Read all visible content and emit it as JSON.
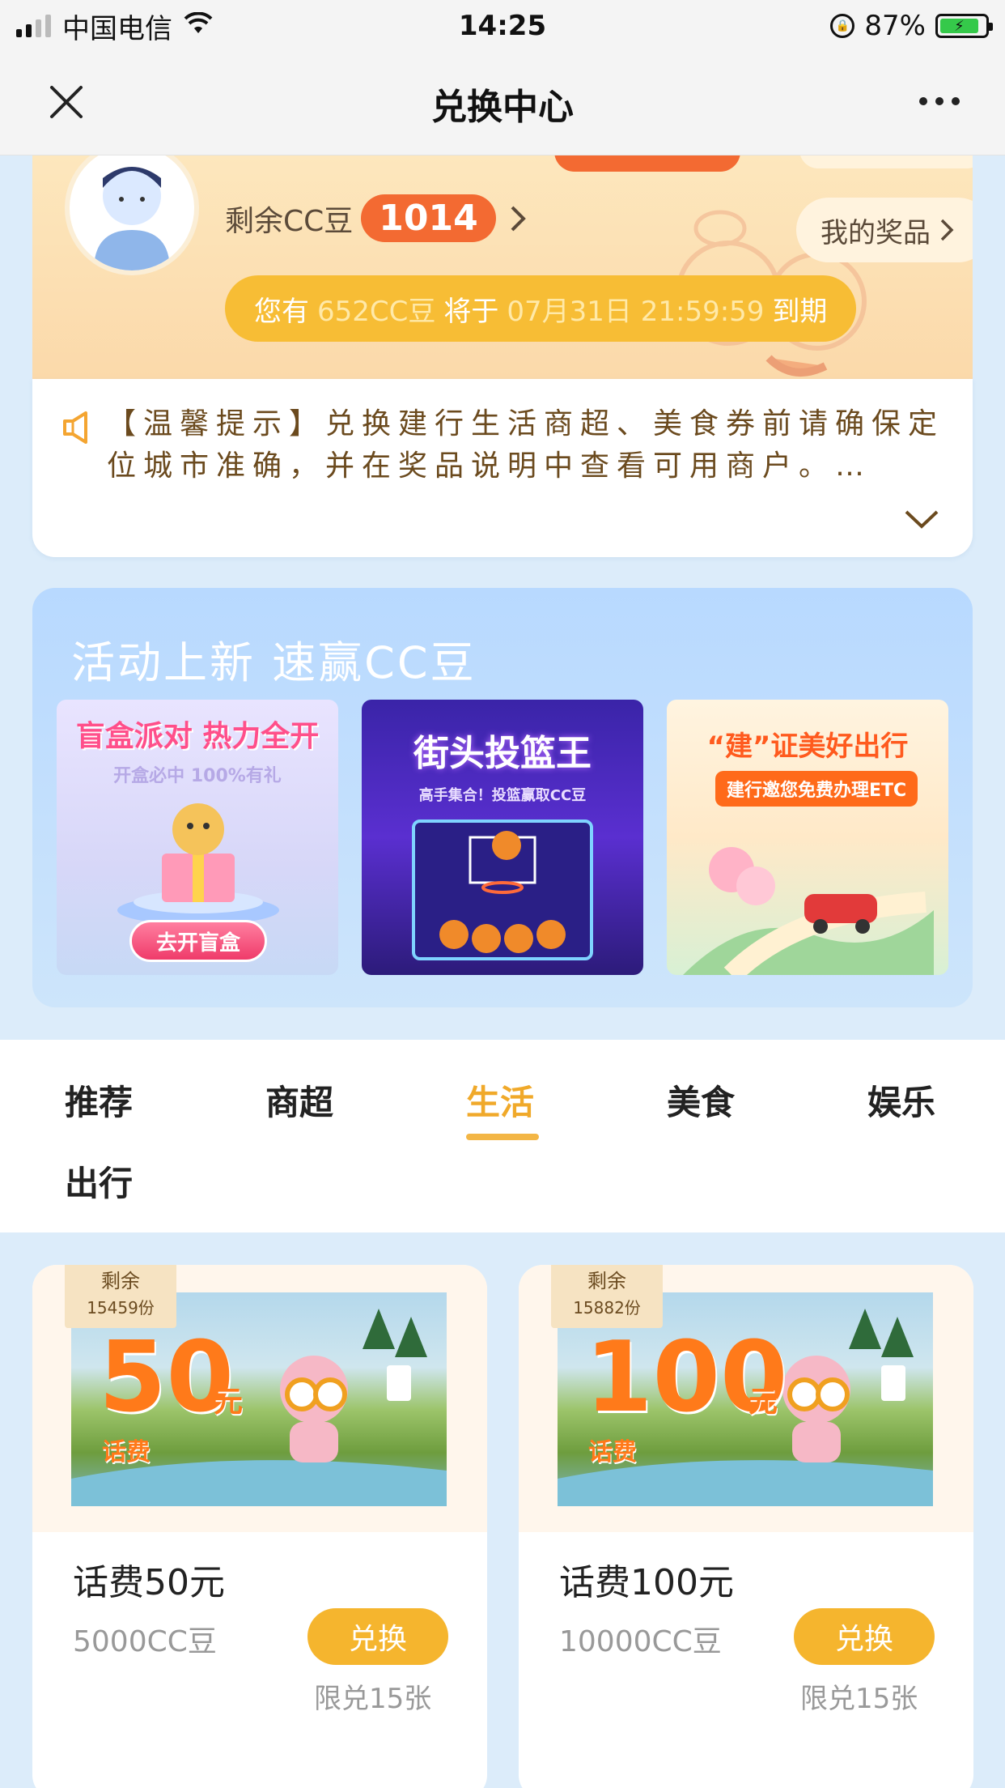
{
  "status_bar": {
    "carrier": "中国电信",
    "time": "14:25",
    "battery_percent": "87%",
    "battery_level": 0.87
  },
  "nav": {
    "title": "兑换中心",
    "close_icon": "close-icon",
    "more_icon": "more-icon"
  },
  "header": {
    "beans_label": "剩余CC豆",
    "beans_value": "1014",
    "prize_button": "我的奖品",
    "expiry": {
      "prefix": "您有",
      "amount": "652CC豆",
      "middle": "将于",
      "datetime": "07月31日 21:59:59",
      "suffix": "到期"
    }
  },
  "notice": {
    "text": "【温馨提示】兑换建行生活商超、美食券前请确保定位城市准确，并在奖品说明中查看可用商户。…"
  },
  "activity": {
    "title": "活动上新 速赢CC豆",
    "cards": [
      {
        "headline": "盲盒派对 热力全开",
        "sub": "开盒必中 100%有礼",
        "button": "去开盲盒"
      },
      {
        "headline": "街头投篮王",
        "sub": "高手集合！投篮赢取CC豆"
      },
      {
        "headline": "“建”证美好出行",
        "sub": "建行邀您免费办理ETC"
      }
    ]
  },
  "tabs": {
    "items": [
      "推荐",
      "商超",
      "生活",
      "美食",
      "娱乐",
      "出行"
    ],
    "active_index": 2
  },
  "products": [
    {
      "remain_label": "剩余",
      "remain_count": "15459份",
      "amount": "50",
      "unit": "元",
      "kind": "话费",
      "title": "话费50元",
      "price": "5000CC豆",
      "button": "兑换",
      "limit": "限兑15张"
    },
    {
      "remain_label": "剩余",
      "remain_count": "15882份",
      "amount": "100",
      "unit": "元",
      "kind": "话费",
      "title": "话费100元",
      "price": "10000CC豆",
      "button": "兑换",
      "limit": "限兑15张"
    }
  ],
  "colors": {
    "accent_orange": "#f36a32",
    "accent_yellow": "#f5b52e",
    "active_tab": "#f0a92a"
  }
}
